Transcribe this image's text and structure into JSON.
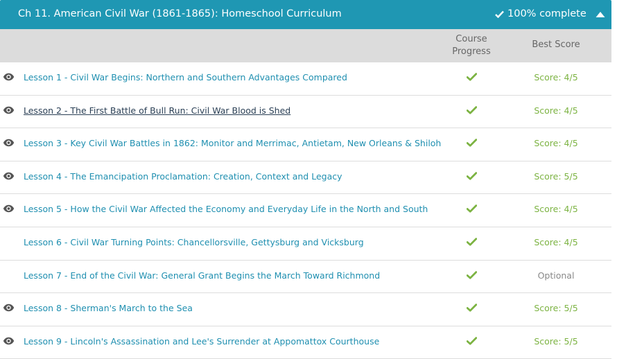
{
  "chapter": {
    "title": "Ch 11. American Civil War (1861-1865): Homeschool Curriculum",
    "progress_text": "100% complete"
  },
  "columns": {
    "course_progress_line1": "Course",
    "course_progress_line2": "Progress",
    "best_score": "Best Score"
  },
  "colors": {
    "header_bg": "#1f97b3",
    "link": "#1f8fb0",
    "check": "#7cb342",
    "score": "#7cb342"
  },
  "lessons": [
    {
      "title": "Lesson 1 - Civil War Begins: Northern and Southern Advantages Compared",
      "score": "Score: 4/5",
      "viewed": true
    },
    {
      "title": "Lesson 2 - The First Battle of Bull Run: Civil War Blood is Shed",
      "score": "Score: 4/5",
      "viewed": true
    },
    {
      "title": "Lesson 3 - Key Civil War Battles in 1862: Monitor and Merrimac, Antietam, New Orleans & Shiloh",
      "score": "Score: 4/5",
      "viewed": true
    },
    {
      "title": "Lesson 4 - The Emancipation Proclamation: Creation, Context and Legacy",
      "score": "Score: 5/5",
      "viewed": true
    },
    {
      "title": "Lesson 5 - How the Civil War Affected the Economy and Everyday Life in the North and South",
      "score": "Score: 4/5",
      "viewed": true
    },
    {
      "title": "Lesson 6 - Civil War Turning Points: Chancellorsville, Gettysburg and Vicksburg",
      "score": "Score: 4/5",
      "viewed": false
    },
    {
      "title": "Lesson 7 - End of the Civil War: General Grant Begins the March Toward Richmond",
      "score": "Optional",
      "viewed": false
    },
    {
      "title": "Lesson 8 - Sherman's March to the Sea",
      "score": "Score: 5/5",
      "viewed": true
    },
    {
      "title": "Lesson 9 - Lincoln's Assassination and Lee's Surrender at Appomattox Courthouse",
      "score": "Score: 5/5",
      "viewed": true
    }
  ]
}
